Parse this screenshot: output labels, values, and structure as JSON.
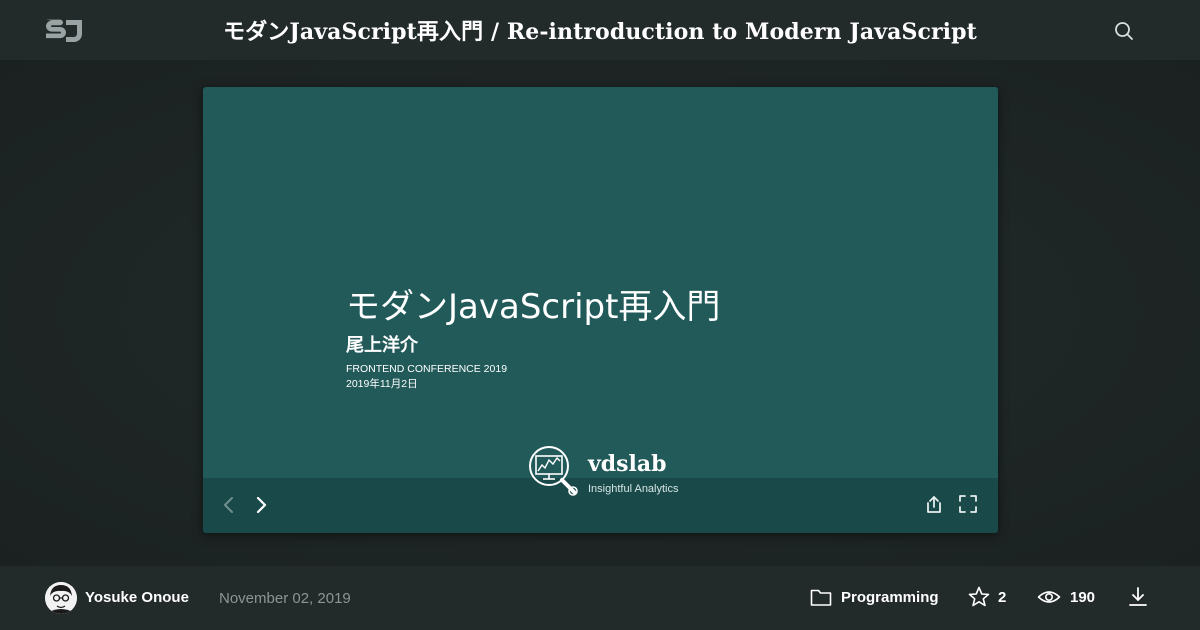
{
  "header": {
    "logo_text": "SJ",
    "title": "モダンJavaScript再入門 / Re-introduction to Modern JavaScript",
    "search_icon": "search-icon"
  },
  "slide": {
    "title": "モダンJavaScript再入門",
    "author": "尾上洋介",
    "event": "FRONTEND CONFERENCE 2019",
    "date": "2019年11月2日",
    "brand_name": "vdslab",
    "brand_tagline": "Insightful Analytics",
    "background_color": "#225a5a"
  },
  "controls": {
    "prev_icon": "chevron-left-icon",
    "next_icon": "chevron-right-icon",
    "share_icon": "share-icon",
    "fullscreen_icon": "fullscreen-icon"
  },
  "footer": {
    "author_name": "Yosuke Onoue",
    "published_date": "November 02, 2019",
    "category": "Programming",
    "stars": "2",
    "views": "190",
    "download_icon": "download-icon"
  },
  "colors": {
    "header_bg": "#232a2a",
    "stage_bg": "#1e2424",
    "muted_text": "#8b9595"
  }
}
